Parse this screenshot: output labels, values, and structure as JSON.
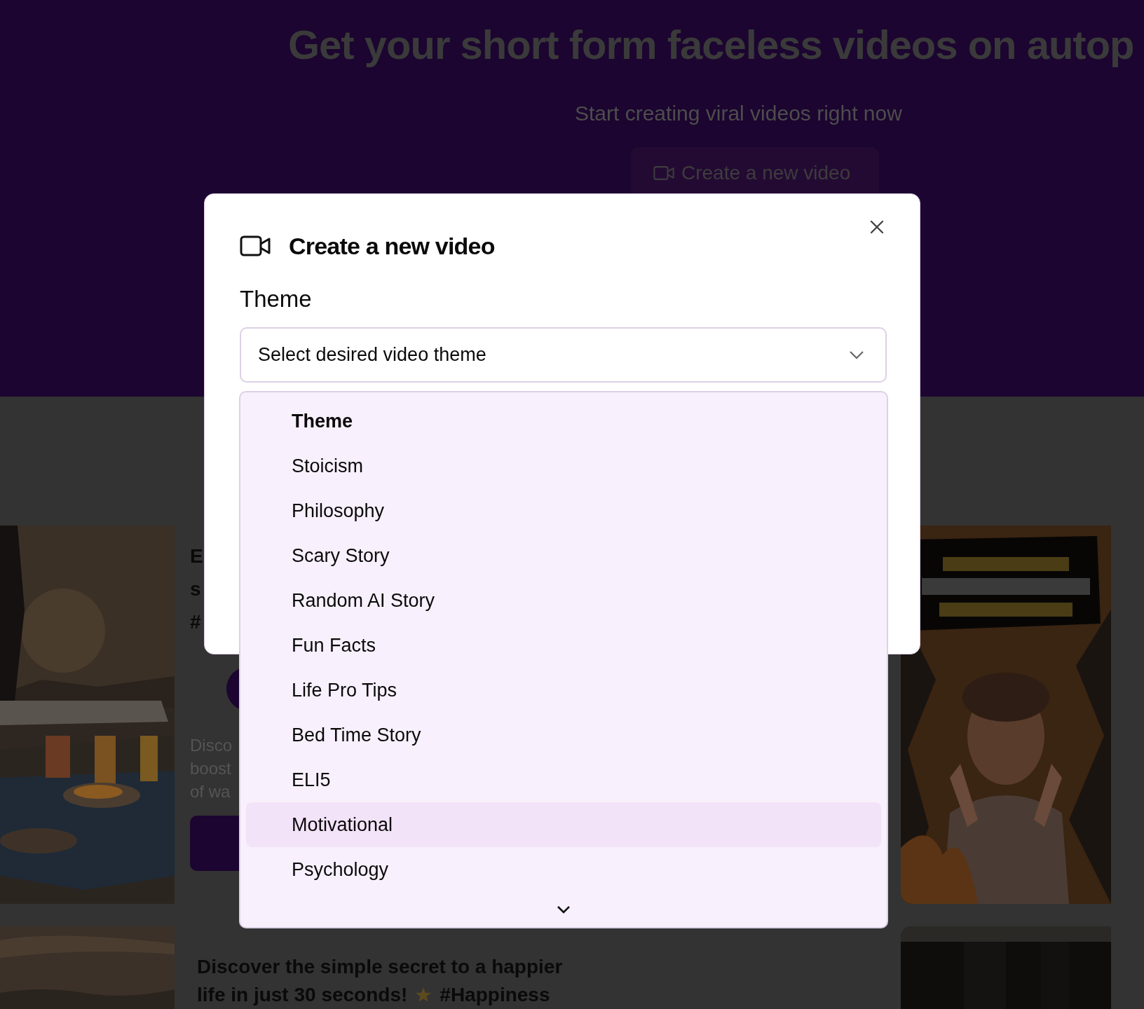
{
  "hero": {
    "title": "Get your short form faceless videos on autop",
    "subtitle": "Start creating viral videos right now",
    "button": "Create a new video"
  },
  "feed": {
    "first_card": {
      "title_fragments": [
        "E",
        "s",
        "#"
      ],
      "description_fragments": [
        "Disco",
        "boost",
        "of wa"
      ]
    },
    "second_card": {
      "title_lines": [
        "Discover the simple secret to a happier",
        "life in just 30 seconds!"
      ],
      "hashtag": "#Happiness"
    }
  },
  "modal": {
    "title": "Create a new video",
    "field_label": "Theme",
    "select": {
      "placeholder": "Select desired video theme"
    },
    "dropdown": {
      "items": [
        {
          "kind": "label",
          "text": "Theme"
        },
        {
          "kind": "option",
          "text": "Stoicism",
          "highlighted": false
        },
        {
          "kind": "option",
          "text": "Philosophy",
          "highlighted": false
        },
        {
          "kind": "option",
          "text": "Scary Story",
          "highlighted": false
        },
        {
          "kind": "option",
          "text": "Random AI Story",
          "highlighted": false
        },
        {
          "kind": "option",
          "text": "Fun Facts",
          "highlighted": false
        },
        {
          "kind": "option",
          "text": "Life Pro Tips",
          "highlighted": false
        },
        {
          "kind": "option",
          "text": "Bed Time Story",
          "highlighted": false
        },
        {
          "kind": "option",
          "text": "ELI5",
          "highlighted": false
        },
        {
          "kind": "option",
          "text": "Motivational",
          "highlighted": true
        },
        {
          "kind": "option",
          "text": "Psychology",
          "highlighted": false
        }
      ]
    }
  }
}
